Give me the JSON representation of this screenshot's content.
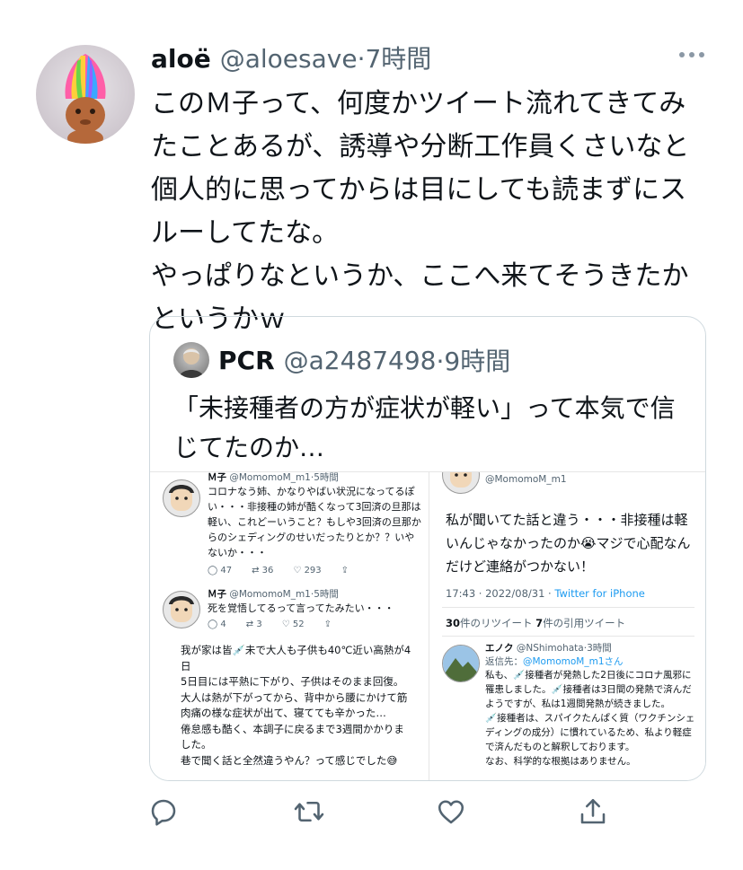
{
  "tweet": {
    "author_name": "aloë",
    "author_handle": "@aloesave",
    "time": "·7時間",
    "text": "このＭ子って、何度かツイート流れてきてみたことあるが、誘導や分断工作員くさいなと個人的に思ってからは目にしても読まずにスルーしてたな。\nやっぱりなというか、ここへ来てそうきたかというかｗ"
  },
  "quote": {
    "author_name": "PCR",
    "author_handle": "@a2487498",
    "time": "·9時間",
    "text": "「未接種者の方が症状が軽い」って本気で信じてたのか…",
    "media": {
      "left": {
        "post1": {
          "name": "Ｍ子",
          "handle": "@MomomoM_m1",
          "time": "·5時間",
          "text": "コロナなう姉、かなりやばい状況になってるぽい・・・非接種の姉が酷くなって3回済の旦那は軽い、これどーいうこと？もしや3回済の旦那からのシェディングのせいだったりとか？？いやないか・・・",
          "replies": "47",
          "retweets": "36",
          "likes": "293"
        },
        "post2": {
          "name": "Ｍ子",
          "handle": "@MomomoM_m1",
          "time": "·5時間",
          "text": "死を覚悟してるって言ってたみたい・・・",
          "replies": "4",
          "retweets": "3",
          "likes": "52"
        },
        "post3_text": "我が家は皆💉未で大人も子供も40℃近い高熱が4日\n5日目には平熱に下がり、子供はそのまま回復。\n大人は熱が下がってから、背中から腰にかけて筋肉痛の様な症状が出て、寝てても辛かった…\n倦怠感も酷く、本調子に戻るまで3週間かかりました。\n巷で聞く話と全然違うやん？って感じでした😅"
      },
      "right": {
        "handle_top": "@MomomoM_m1",
        "text": "私が聞いてた話と違う・・・非接種は軽いんじゃなかったのか😭マジで心配なんだけど連絡がつかない！",
        "timestamp": "17:43 · 2022/08/31 · ",
        "source": "Twitter for iPhone",
        "retweet_count": "30",
        "retweet_label": "件のリツイート",
        "quote_count": "7",
        "quote_label": "件の引用ツイート",
        "reply": {
          "name": "エノク",
          "handle": "@NShimohata",
          "time": "·3時間",
          "reply_to_label": "返信先：",
          "reply_to_handle": "@MomomoM_m1さん",
          "text": "私も、💉接種者が発熱した2日後にコロナ風邪に罹患しました。💉接種者は3日間の発熱で済んだようですが、私は1週間発熱が続きました。\n💉接種者は、スパイクたんぱく質（ワクチンシェディングの成分）に慣れているため、私より軽症で済んだものと解釈しております。\nなお、科学的な根拠はありません。"
        }
      }
    }
  },
  "icons": {
    "more": "more-dots-icon",
    "reply": "reply-icon",
    "retweet": "retweet-icon",
    "like": "heart-icon",
    "share": "share-icon"
  },
  "colors": {
    "text": "#0f1419",
    "secondary": "#536471",
    "link": "#1d9bf0",
    "border": "#cfd9de"
  }
}
